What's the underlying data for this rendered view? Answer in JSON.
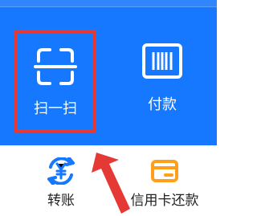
{
  "colors": {
    "panel_blue": "#1677ff",
    "annotation_red": "#e53935",
    "transfer_icon_blue": "#1677ff",
    "credit_icon_orange": "#ff9f1a"
  },
  "top_actions": {
    "scan": {
      "label": "扫一扫",
      "icon": "scan-icon"
    },
    "pay": {
      "label": "付款",
      "icon": "barcode-payment-icon"
    }
  },
  "bottom_actions": {
    "transfer": {
      "label": "转账",
      "icon": "yen-transfer-icon"
    },
    "credit_card_repayment": {
      "label": "信用卡还款",
      "icon": "credit-card-icon"
    }
  },
  "annotation": {
    "highlight": "scan-action",
    "arrow": "red-arrow-icon"
  }
}
